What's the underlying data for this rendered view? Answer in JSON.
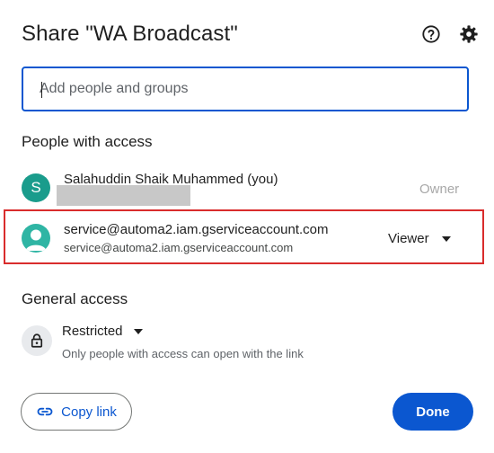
{
  "dialog": {
    "title": "Share \"WA Broadcast\"",
    "help_icon": "help-circle-icon",
    "settings_icon": "gear-icon"
  },
  "search": {
    "placeholder": "Add people and groups",
    "value": ""
  },
  "people_section": {
    "label": "People with access",
    "people": [
      {
        "avatar_letter": "S",
        "avatar_color": "#1a9c8c",
        "name": "Salahuddin Shaik Muhammed (you)",
        "role": "Owner"
      },
      {
        "avatar_icon": "person-icon",
        "avatar_color": "#2fb5a4",
        "name": "service@automa2.iam.gserviceaccount.com",
        "email": "service@automa2.iam.gserviceaccount.com",
        "role": "Viewer"
      }
    ]
  },
  "general_access": {
    "label": "General access",
    "icon": "lock-icon",
    "mode": "Restricted",
    "description": "Only people with access can open with the link"
  },
  "footer": {
    "copy_link_label": "Copy link",
    "copy_link_icon": "link-icon",
    "done_label": "Done"
  },
  "colors": {
    "accent": "#0b57d0",
    "highlight_box": "#d92c2c"
  }
}
